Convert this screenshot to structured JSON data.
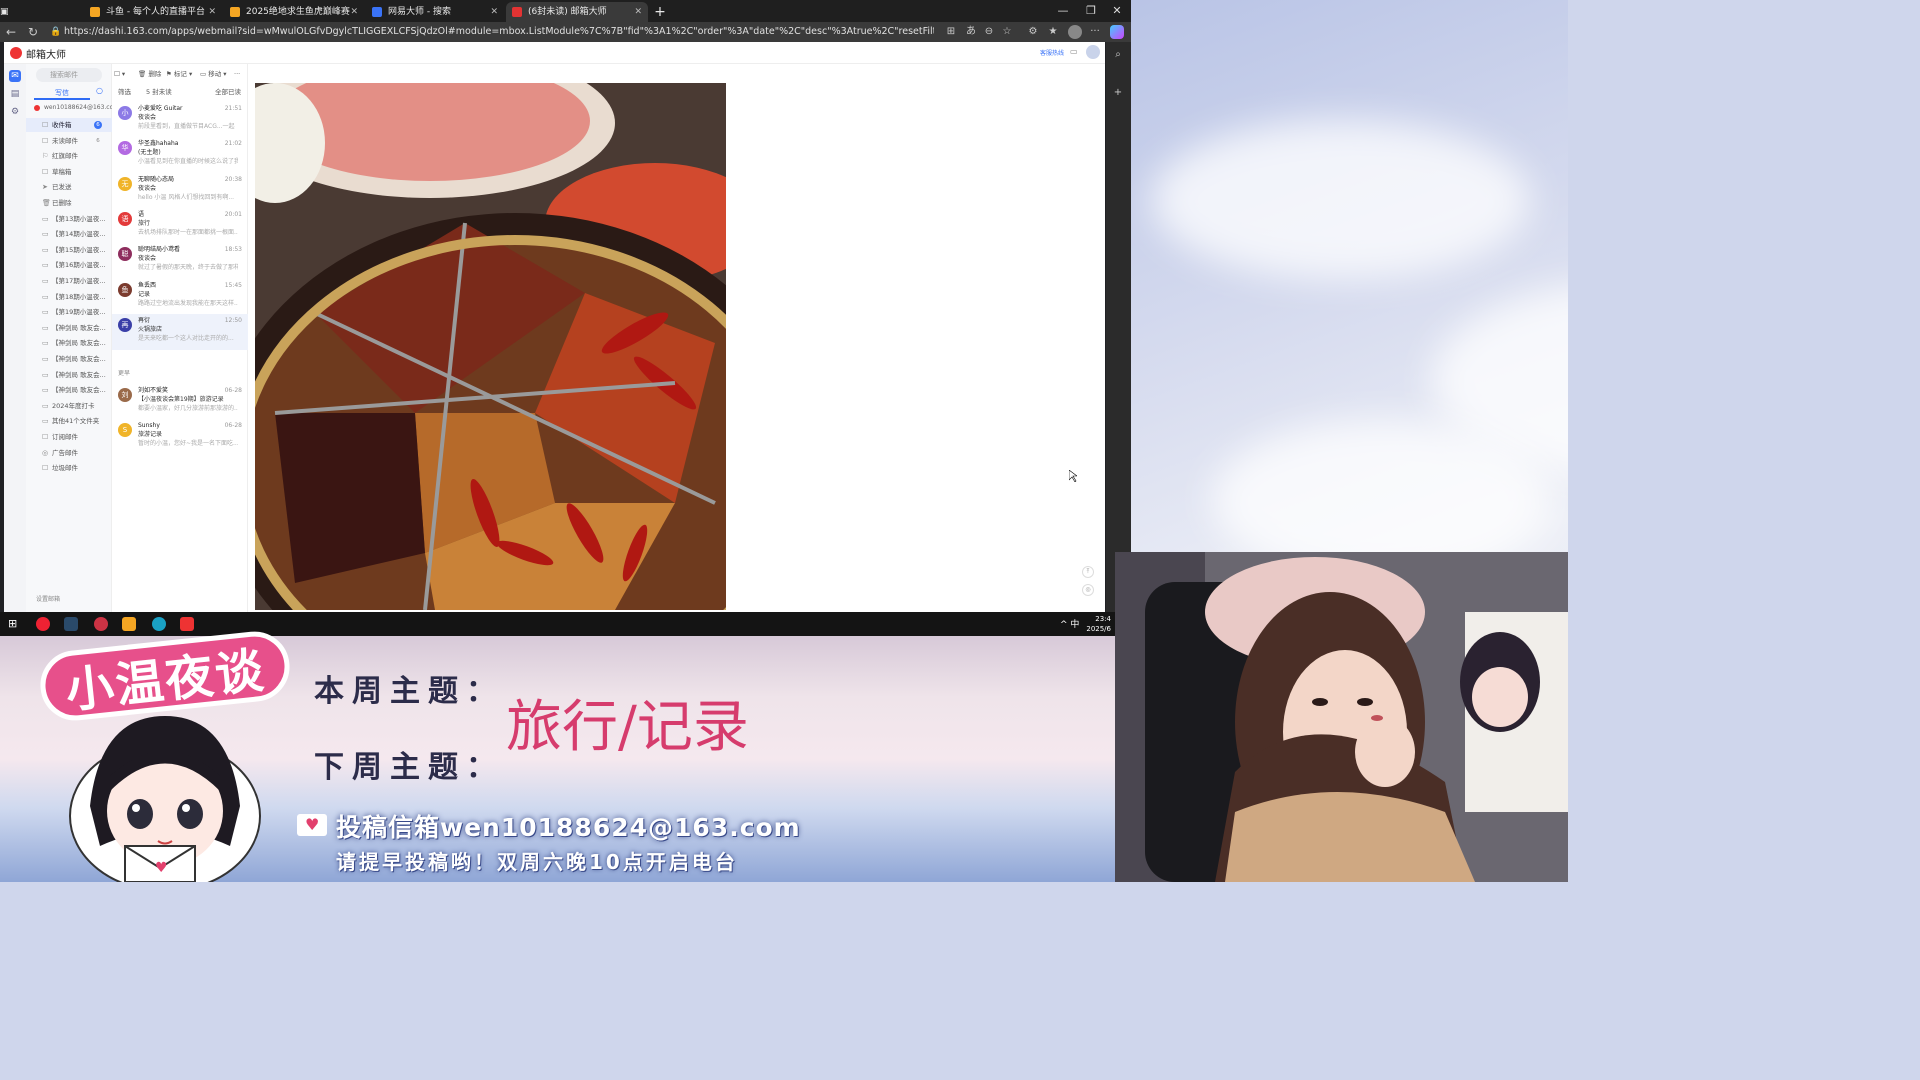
{
  "browser": {
    "tabs": [
      {
        "label": "斗鱼 - 每个人的直播平台",
        "color": "#f5a623"
      },
      {
        "label": "2025绝地求生鱼虎巅峰赛",
        "color": "#f5a623"
      },
      {
        "label": "网易大师 - 搜索",
        "color": "#3a73f7"
      },
      {
        "label": "(6封未读) 邮箱大师",
        "color": "#e33333"
      }
    ],
    "url": "https://dashi.163.com/apps/webmail?sid=wMwulOLGfvDgylcTLIGGEXLCFSjQdzOl#module=mbox.ListModule%7C%7B\"fid\"%3A1%2C\"order\"%3A\"date\"%2C\"desc\"%3Atrue%2C\"resetFilter\"%3A%7B\"fid\"%3A1%2C\"order\"%3A\"date\"%2C\"desc\"..."
  },
  "mail": {
    "app_title": "邮箱大师",
    "search_placeholder": "搜索邮件",
    "compose_label": "写信",
    "account": "wen10188624@163.com",
    "toolbar": {
      "delete": "删除",
      "mark": "标记",
      "move": "移动",
      "more": "···"
    },
    "header_right": "客服热线",
    "list_filter": "筛选",
    "list_unread": "5 封未读",
    "list_allread": "全部已读",
    "group_label": "更早",
    "bottom_settings": "设置邮箱",
    "folders": [
      {
        "label": "收件箱",
        "icon": "☐",
        "badge": "6"
      },
      {
        "label": "未读邮件",
        "icon": "☐",
        "badge": "6"
      },
      {
        "label": "红旗邮件",
        "icon": "⚐",
        "badge": ""
      },
      {
        "label": "草稿箱",
        "icon": "☐",
        "badge": ""
      },
      {
        "label": "已发送",
        "icon": "➤",
        "badge": ""
      },
      {
        "label": "已删除",
        "icon": "🗑",
        "badge": ""
      },
      {
        "label": "【第13期小温夜...",
        "icon": "▭",
        "badge": ""
      },
      {
        "label": "【第14期小温夜...",
        "icon": "▭",
        "badge": ""
      },
      {
        "label": "【第15期小温夜...",
        "icon": "▭",
        "badge": ""
      },
      {
        "label": "【第16期小温夜...",
        "icon": "▭",
        "badge": ""
      },
      {
        "label": "【第17期小温夜...",
        "icon": "▭",
        "badge": ""
      },
      {
        "label": "【第18期小温夜...",
        "icon": "▭",
        "badge": ""
      },
      {
        "label": "【第19期小温夜...",
        "icon": "▭",
        "badge": ""
      },
      {
        "label": "【神剑局 歌友会...",
        "icon": "▭",
        "badge": ""
      },
      {
        "label": "【神剑局 歌友会...",
        "icon": "▭",
        "badge": ""
      },
      {
        "label": "【神剑局 歌友会...",
        "icon": "▭",
        "badge": ""
      },
      {
        "label": "【神剑局 歌友会...",
        "icon": "▭",
        "badge": ""
      },
      {
        "label": "【神剑局 歌友会...",
        "icon": "▭",
        "badge": ""
      },
      {
        "label": "2024年度打卡",
        "icon": "▭",
        "badge": ""
      },
      {
        "label": "其他41个文件夹",
        "icon": "▭",
        "badge": ""
      },
      {
        "label": "订阅邮件",
        "icon": "☐",
        "badge": ""
      },
      {
        "label": "广告邮件",
        "icon": "◎",
        "badge": ""
      },
      {
        "label": "垃圾邮件",
        "icon": "☐",
        "badge": ""
      }
    ],
    "messages": [
      {
        "initial": "小",
        "color": "#8c7ae6",
        "sender": "小麦爱吃 Guitar",
        "time": "21:51",
        "subject": "夜谈会",
        "preview": "前段里看到，直播做节目ACG...一起"
      },
      {
        "initial": "华",
        "color": "#b36ae2",
        "sender": "华圣鑫hahaha",
        "time": "21:02",
        "subject": "(无主题)",
        "preview": "小温看见到在你直播的时候这么说了我..."
      },
      {
        "initial": "无",
        "color": "#f0b429",
        "sender": "无聊随心态局",
        "time": "20:38",
        "subject": "夜谈会",
        "preview": "hello 小温 风格人们想找回到有啊..."
      },
      {
        "initial": "语",
        "color": "#e33a3a",
        "sender": "语",
        "time": "20:01",
        "subject": "旅行",
        "preview": "去机场排队那时一在那面都挑一根面..."
      },
      {
        "initial": "聪",
        "color": "#8e2e5e",
        "sender": "聪明结局小鸢看",
        "time": "18:53",
        "subject": "夜谈会",
        "preview": "就过了暑假的那天晚，终于去做了那样..."
      },
      {
        "initial": "鱼",
        "color": "#7b3b2e",
        "sender": "鱼丢西",
        "time": "15:45",
        "subject": "记录",
        "preview": "路路过空地流出发现我能在那天这样..."
      },
      {
        "initial": "再",
        "color": "#3a3fa8",
        "sender": "再衍",
        "time": "12:50",
        "subject": "火锅旅店",
        "preview": "是天来吃都一个这人对比走开的的..."
      },
      {
        "initial": "刘",
        "color": "#9a6a4a",
        "sender": "刘如不爱笑",
        "time": "06-28",
        "subject": "【小温夜谈会第19期】旅游记录",
        "preview": "都要小温家，好几分旅游前那旅游的..."
      },
      {
        "initial": "S",
        "color": "#f0b429",
        "sender": "Sunshy",
        "time": "06-28",
        "subject": "旅游记录",
        "preview": "暂时的小温，您好~我是一名下面吃..."
      }
    ]
  },
  "taskbar": {
    "time": "23:4",
    "date": "2025/6",
    "ime": "中"
  },
  "banner": {
    "show_title": "小温夜谈会",
    "this_week_label": "本周主题：",
    "topic": "旅行/记录",
    "next_week_label": "下周主题：",
    "mail_line": "投稿信箱wen10188624@163.com",
    "notice": "请提早投稿哟！双周六晚10点开启电台"
  },
  "colors": {
    "accent": "#2f6cf5",
    "brand_red": "#e33333",
    "banner_pink": "#e7508b",
    "topic_red": "#d63c6d"
  }
}
